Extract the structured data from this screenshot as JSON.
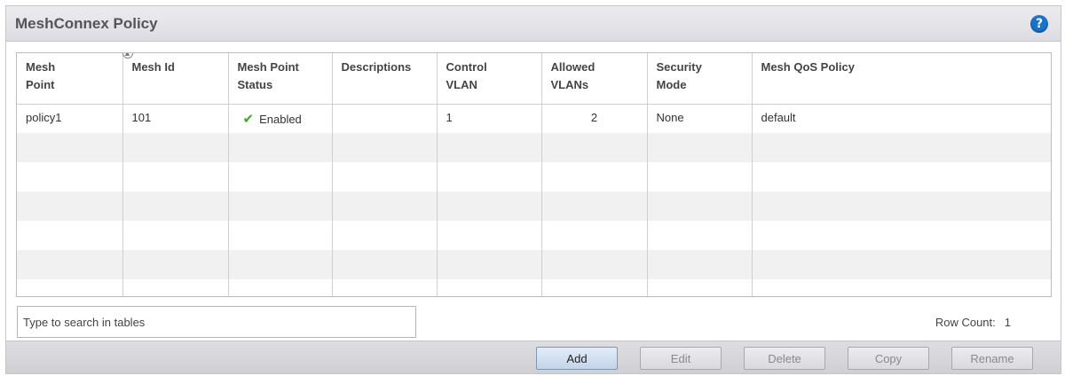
{
  "panel": {
    "title": "MeshConnex Policy",
    "help_icon": "question-circle-icon"
  },
  "table": {
    "columns": [
      {
        "label": "Mesh Point",
        "sortable": true
      },
      {
        "label": "Mesh Id"
      },
      {
        "label": "Mesh Point Status"
      },
      {
        "label": "Descriptions"
      },
      {
        "label": "Control VLAN"
      },
      {
        "label": "Allowed VLANs"
      },
      {
        "label": "Security Mode"
      },
      {
        "label": "Mesh QoS Policy"
      }
    ],
    "rows": [
      {
        "mesh_point": "policy1",
        "mesh_id": "101",
        "status": "Enabled",
        "status_icon": "check-icon",
        "descriptions": "",
        "control_vlan": "1",
        "allowed_vlans": "2",
        "security_mode": "None",
        "qos_policy": "default"
      }
    ]
  },
  "search": {
    "placeholder": "Type to search in tables"
  },
  "row_count": {
    "label": "Row Count:",
    "value": "1"
  },
  "buttons": {
    "add": "Add",
    "edit": "Edit",
    "delete": "Delete",
    "copy": "Copy",
    "rename": "Rename"
  },
  "colors": {
    "help_blue": "#1a73c9",
    "check_green": "#3fa535"
  }
}
